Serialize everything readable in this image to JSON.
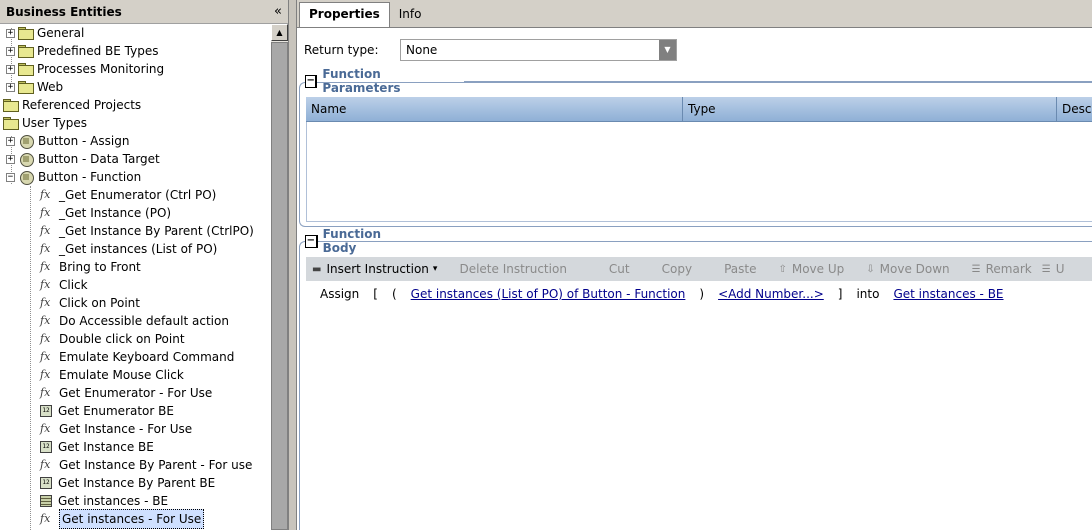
{
  "left_panel": {
    "title": "Business Entities",
    "collapse_glyph": "«",
    "tree": [
      {
        "label": "General",
        "icon": "folder-icon",
        "expander": "+",
        "level": 0
      },
      {
        "label": "Predefined BE Types",
        "icon": "folder-icon",
        "expander": "+",
        "level": 0
      },
      {
        "label": "Processes Monitoring",
        "icon": "folder-icon",
        "expander": "+",
        "level": 0
      },
      {
        "label": "Web",
        "icon": "folder-icon",
        "expander": "+",
        "level": 0
      },
      {
        "label": "Referenced Projects",
        "icon": "folder-icon",
        "expander": "",
        "level": -1
      },
      {
        "label": "User Types",
        "icon": "folder-icon",
        "expander": "",
        "level": -1
      },
      {
        "label": "Button - Assign",
        "icon": "entity-icon",
        "expander": "+",
        "level": 0
      },
      {
        "label": "Button - Data Target",
        "icon": "entity-icon",
        "expander": "+",
        "level": 0
      },
      {
        "label": "Button - Function",
        "icon": "entity-icon",
        "expander": "−",
        "level": 0
      },
      {
        "label": "_Get Enumerator (Ctrl PO)",
        "icon": "function-icon",
        "level": 1
      },
      {
        "label": "_Get Instance (PO)",
        "icon": "function-icon",
        "level": 1
      },
      {
        "label": "_Get Instance By Parent (CtrlPO)",
        "icon": "function-icon",
        "level": 1
      },
      {
        "label": "_Get instances (List of PO)",
        "icon": "function-icon",
        "level": 1
      },
      {
        "label": "Bring to Front",
        "icon": "function-icon",
        "level": 1
      },
      {
        "label": "Click",
        "icon": "function-icon",
        "level": 1
      },
      {
        "label": "Click on Point",
        "icon": "function-icon",
        "level": 1
      },
      {
        "label": "Do Accessible default action",
        "icon": "function-icon",
        "level": 1
      },
      {
        "label": "Double click on Point",
        "icon": "function-icon",
        "level": 1
      },
      {
        "label": "Emulate Keyboard Command",
        "icon": "function-icon",
        "level": 1
      },
      {
        "label": "Emulate Mouse Click",
        "icon": "function-icon",
        "level": 1
      },
      {
        "label": "Get Enumerator - For Use",
        "icon": "function-icon",
        "level": 1
      },
      {
        "label": "Get Enumerator BE",
        "icon": "number-icon",
        "level": 1
      },
      {
        "label": "Get Instance - For Use",
        "icon": "function-icon",
        "level": 1
      },
      {
        "label": "Get Instance BE",
        "icon": "number-icon",
        "level": 1
      },
      {
        "label": "Get Instance By Parent - For use",
        "icon": "function-icon",
        "level": 1
      },
      {
        "label": "Get Instance By Parent BE",
        "icon": "number-icon",
        "level": 1
      },
      {
        "label": "Get instances - BE",
        "icon": "list-icon",
        "level": 1
      },
      {
        "label": "Get instances - For Use",
        "icon": "function-icon",
        "level": 1,
        "selected": true
      }
    ]
  },
  "tabs": [
    {
      "label": "Properties",
      "active": true
    },
    {
      "label": "Info",
      "active": false
    }
  ],
  "return_type": {
    "label": "Return type:",
    "value": "None"
  },
  "function_parameters": {
    "title": "Function Parameters",
    "columns": [
      "Name",
      "Type",
      "Desc"
    ]
  },
  "function_body": {
    "title": "Function Body",
    "toolbar": [
      {
        "label": "Insert Instruction",
        "icon": "insert-icon",
        "enabled": true,
        "dropdown": "▾"
      },
      {
        "label": "Delete Instruction",
        "enabled": false
      },
      {
        "label": "Cut",
        "enabled": false
      },
      {
        "label": "Copy",
        "enabled": false
      },
      {
        "label": "Paste",
        "enabled": false
      },
      {
        "label": "Move Up",
        "icon": "move-up-icon",
        "enabled": false
      },
      {
        "label": "Move Down",
        "icon": "move-down-icon",
        "enabled": false
      },
      {
        "label": "Remark",
        "icon": "remark-icon",
        "enabled": false
      },
      {
        "label": "U",
        "icon": "unremark-icon",
        "enabled": false
      }
    ],
    "instruction": {
      "keyword": "Assign",
      "open_bracket": "[",
      "open_paren": "(",
      "source": "Get instances (List of PO) of Button - Function",
      "close_paren": ")",
      "add_number": "<Add Number...>",
      "close_bracket": "]",
      "into": "into",
      "target": "Get instances - BE"
    }
  }
}
